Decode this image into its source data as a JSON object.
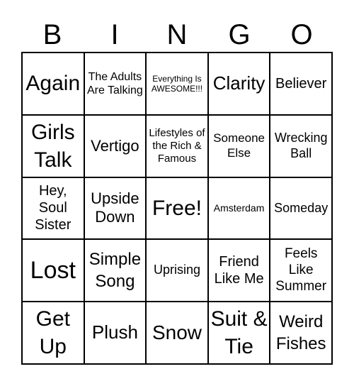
{
  "header": [
    "B",
    "I",
    "N",
    "G",
    "O"
  ],
  "cells": [
    "Again",
    "The Adults Are Talking",
    "Everything Is AWESOME!!!",
    "Clarity",
    "Believer",
    "Girls Talk",
    "Vertigo",
    "Lifestyles of the Rich & Famous",
    "Someone Else",
    "Wrecking Ball",
    "Hey, Soul Sister",
    "Upside Down",
    "Free!",
    "Amsterdam",
    "Someday",
    "Lost",
    "Simple Song",
    "Uprising",
    "Friend Like Me",
    "Feels Like Summer",
    "Get Up",
    "Plush",
    "Snow",
    "Suit & Tie",
    "Weird Fishes"
  ]
}
